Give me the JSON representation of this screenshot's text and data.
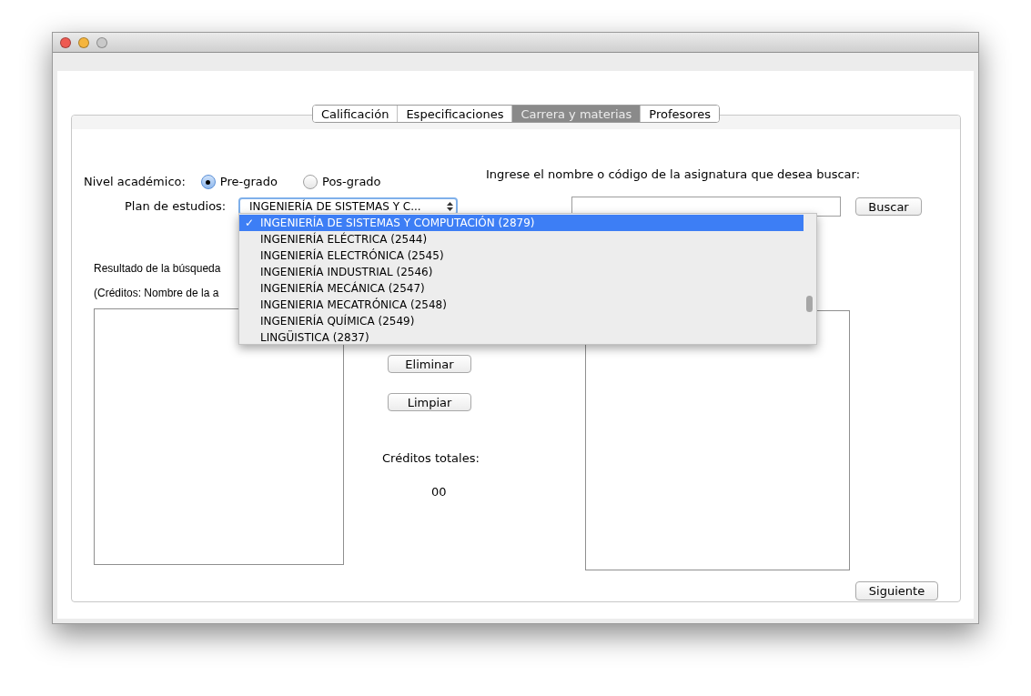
{
  "tabs": [
    {
      "label": "Calificación",
      "selected": false
    },
    {
      "label": "Especificaciones",
      "selected": false
    },
    {
      "label": "Carrera y materias",
      "selected": true
    },
    {
      "label": "Profesores",
      "selected": false
    }
  ],
  "nivel": {
    "label": "Nivel académico:",
    "options": [
      {
        "label": "Pre-grado",
        "selected": true
      },
      {
        "label": "Pos-grado",
        "selected": false
      }
    ]
  },
  "plan": {
    "label": "Plan de estudios:",
    "value": "INGENIERÍA DE SISTEMAS Y C...",
    "options": [
      {
        "label": "INGENIERÍA DE SISTEMAS Y COMPUTACIÓN (2879)",
        "selected": true,
        "check": "✓"
      },
      {
        "label": "INGENIERÍA ELÉCTRICA (2544)",
        "selected": false
      },
      {
        "label": "INGENIERÍA ELECTRÓNICA (2545)",
        "selected": false
      },
      {
        "label": "INGENIERÍA INDUSTRIAL (2546)",
        "selected": false
      },
      {
        "label": "INGENIERÍA MECÁNICA (2547)",
        "selected": false
      },
      {
        "label": "INGENIERIA MECATRÓNICA (2548)",
        "selected": false
      },
      {
        "label": "INGENIERÍA QUÍMICA (2549)",
        "selected": false
      },
      {
        "label": "LINGÜISTICA (2837)",
        "selected": false
      }
    ]
  },
  "search": {
    "label": "Ingrese el nombre o código de la asignatura que desea buscar:",
    "button": "Buscar"
  },
  "results": {
    "title": "Resultado de la búsqueda",
    "format": "(Créditos: Nombre de la a"
  },
  "actions": [
    "Eliminar",
    "Limpiar"
  ],
  "credits": {
    "label": "Créditos totales:",
    "value": "00"
  },
  "next_button": "Siguiente"
}
